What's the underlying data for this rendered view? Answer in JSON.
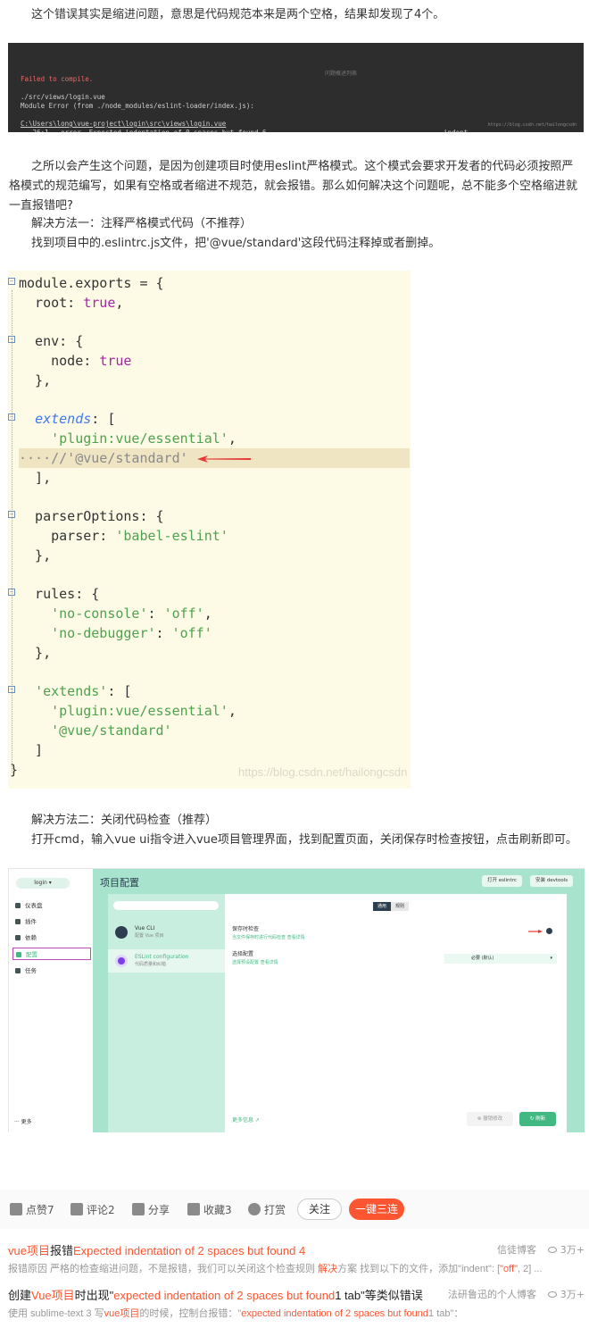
{
  "intro": "这个错误其实是缩进问题，意思是代码规范本来是两个空格，结果却发现了4个。",
  "terminal": {
    "lines": [
      {
        "text": "Failed to compile.",
        "cls": "red"
      },
      {
        "text": "",
        "cls": ""
      },
      {
        "text": "./src/views/login.vue",
        "cls": ""
      },
      {
        "text": "Module Error (from ./node_modules/eslint-loader/index.js):",
        "cls": ""
      },
      {
        "text": "",
        "cls": ""
      },
      {
        "text": "C:\\Users\\long\\vue-project\\login\\src\\views\\login.vue",
        "cls": "ul"
      },
      {
        "text": "   26:1   error  Expected indentation of 0 spaces but found 6                                            indent",
        "cls": ""
      },
      {
        "text": "   27:1   error  Expected indentation of 2 spaces but found 4                                            indent",
        "cls": ""
      }
    ],
    "center_label": "问题概述列表",
    "watermark": "https://blog.csdn.net/hailongcsdn"
  },
  "para2": "之所以会产生这个问题，是因为创建项目时使用eslint严格模式。这个模式会要求开发者的代码必须按照严格模式的规范编写，如果有空格或者缩进不规范，就会报错。那么如何解决这个问题呢，总不能多个空格缩进就一直报错吧?",
  "method1": "解决方法一：注释严格模式代码（不推荐）",
  "method1_desc": "找到项目中的.eslintrc.js文件，把'@vue/standard'这段代码注释掉或者删掉。",
  "code": {
    "watermark": "https://blog.csdn.net/hailongcsdn"
  },
  "method2": "解决方法二：关闭代码检查（推荐）",
  "method2_desc": "打开cmd，输入vue ui指令进入vue项目管理界面，找到配置页面，关闭保存时检查按钮，点击刷新即可。",
  "vueui": {
    "project": "login",
    "sidebar": [
      "仪表盘",
      "插件",
      "依赖",
      "配置",
      "任务"
    ],
    "more": "更多",
    "title": "项目配置",
    "btn_eslintrc": "打开 eslintrc",
    "btn_devtools": "安装 devtools",
    "list": [
      {
        "t1": "Vue CLI",
        "t2": "配置 Vue 项目"
      },
      {
        "t1": "ESLint configuration",
        "t2": "代码质量和纠错"
      }
    ],
    "tabs": [
      "通用",
      "规则"
    ],
    "opt1_title": "保存时检查",
    "opt1_desc": "当文件保存时进行代码检查  查看详情",
    "opt2_title": "选择配置",
    "opt2_desc": "选择预设配置  查看详情",
    "dropdown": "必要 (默认)",
    "more_info": "更多信息",
    "undo": "撤销修改",
    "refresh": "刷新"
  },
  "toolbar": {
    "like": "点赞7",
    "comment": "评论2",
    "share": "分享",
    "collect": "收藏3",
    "reward": "打赏",
    "follow": "关注",
    "triple": "一键三连"
  },
  "recs": [
    {
      "title_parts": [
        [
          "k",
          "vue项目"
        ],
        [
          "",
          "报错"
        ],
        [
          "k",
          "Expected indentation of 2 spaces but found 4"
        ]
      ],
      "source": "信徒博客",
      "views": "3万+",
      "desc_parts": [
        [
          "",
          "报错原因 严格的检查缩进问题，不是报错，我们可以关闭这个检查规则 "
        ],
        [
          "k",
          "解决"
        ],
        [
          "",
          "方案 找到以下的文件，添加\"indent\": ["
        ],
        [
          "k",
          "\"off\""
        ],
        [
          "",
          ", 2] ..."
        ]
      ]
    },
    {
      "title_parts": [
        [
          "",
          "创建"
        ],
        [
          "k",
          "Vue项目"
        ],
        [
          "",
          "时出现\""
        ],
        [
          "k",
          "expected indentation of 2 spaces but found"
        ],
        [
          "",
          ""
        ],
        [
          "",
          "1 tab\"等类似错误"
        ]
      ],
      "source": "法研鲁迅的个人博客",
      "views": "3万+",
      "desc_parts": [
        [
          "",
          "使用 sublime-text 3 写"
        ],
        [
          "k",
          "vue项目"
        ],
        [
          "",
          "的时候，控制台报错：\""
        ],
        [
          "k",
          "expected indentation of 2 spaces but found"
        ],
        [
          "",
          ""
        ],
        [
          "",
          "1 tab\"："
        ]
      ]
    }
  ]
}
